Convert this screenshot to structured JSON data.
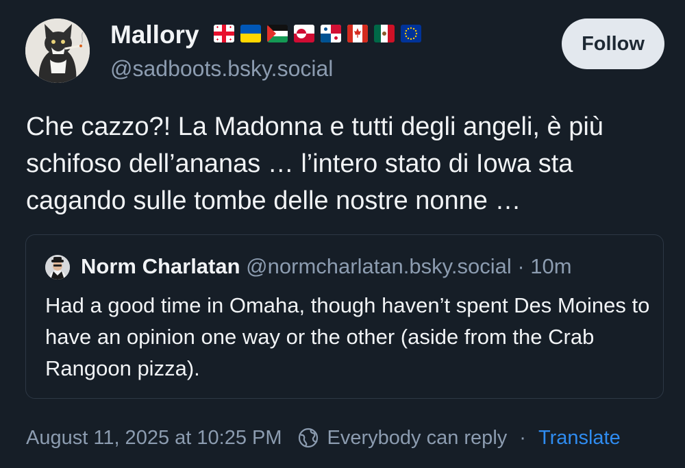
{
  "author": {
    "display_name": "Mallory",
    "handle": "@sadboots.bsky.social",
    "flags": [
      "georgia-flag",
      "ukraine-flag",
      "palestine-flag",
      "greenland-flag",
      "panama-flag",
      "canada-flag",
      "mexico-flag",
      "eu-flag"
    ]
  },
  "follow_button": {
    "label": "Follow"
  },
  "post": {
    "text": "Che cazzo?! La Madonna e tutti degli angeli, è più schifoso dell’ananas … l’intero stato di Iowa sta cagando sulle tombe delle nostre nonne …"
  },
  "quote": {
    "display_name": "Norm Charlatan",
    "handle": "@normcharlatan.bsky.social",
    "separator": " · ",
    "time": "10m",
    "text": "Had a good time in Omaha, though haven’t spent Des Moines to have an opinion one way or the other (aside from the Crab Rangoon pizza)."
  },
  "footer": {
    "timestamp": "August 11, 2025 at 10:25 PM",
    "reply_setting": "Everybody can reply",
    "separator": "·",
    "translate_label": "Translate"
  },
  "colors": {
    "background": "#161e27",
    "text": "#f1f3f5",
    "muted": "#8c9cb0",
    "link": "#2f8cf0",
    "follow_bg": "#e3e8ee"
  }
}
